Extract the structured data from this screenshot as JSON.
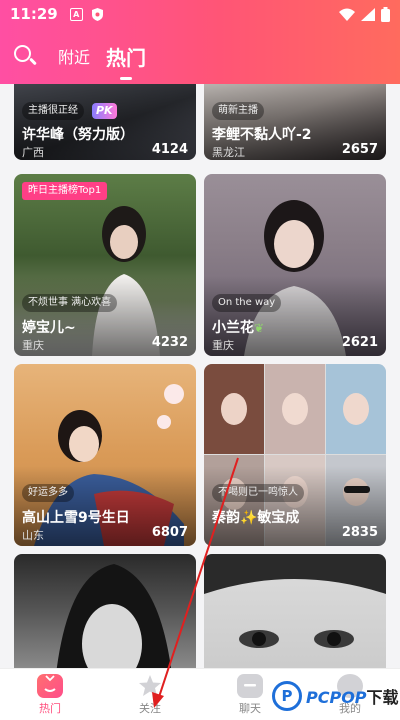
{
  "status_bar": {
    "time": "11:29",
    "icon_a": "A"
  },
  "header": {
    "tabs": [
      {
        "label": "附近"
      },
      {
        "label": "热门"
      }
    ]
  },
  "cards": [
    {
      "tag": "主播很正经",
      "pk": "PK",
      "name": "许华峰（努力版）",
      "location": "广西",
      "count": "4124"
    },
    {
      "tag": "萌新主播",
      "name": "李鲤不黏人吖-2",
      "location": "黑龙江",
      "count": "2657"
    },
    {
      "rank": "昨日主播榜Top1",
      "tag": "不烦世事 满心欢喜",
      "name": "婷宝儿~",
      "location": "重庆",
      "count": "4232"
    },
    {
      "tag": "On the way",
      "name": "小兰花",
      "location": "重庆",
      "count": "2621"
    },
    {
      "tag": "好运多多",
      "name": "高山上雪9号生日",
      "location": "山东",
      "count": "6807"
    },
    {
      "tag": "不喝则已一鸣惊人",
      "name": "秦韵✨敏宝成",
      "count": "2835"
    },
    {},
    {}
  ],
  "bottom_nav": [
    {
      "label": "热门",
      "icon": "tv-icon"
    },
    {
      "label": "关注",
      "icon": "star-icon"
    },
    {
      "label": "聊天",
      "icon": "chat-icon"
    },
    {
      "label": "我的",
      "icon": "person-icon"
    }
  ],
  "watermark": {
    "mark": "P",
    "brand": "PCPOP",
    "suffix": "下载"
  },
  "colors": {
    "header_start": "#ff4fa3",
    "header_end": "#ff6b5e",
    "active": "#ff4f7e",
    "rank_badge": "#ff3f86"
  }
}
